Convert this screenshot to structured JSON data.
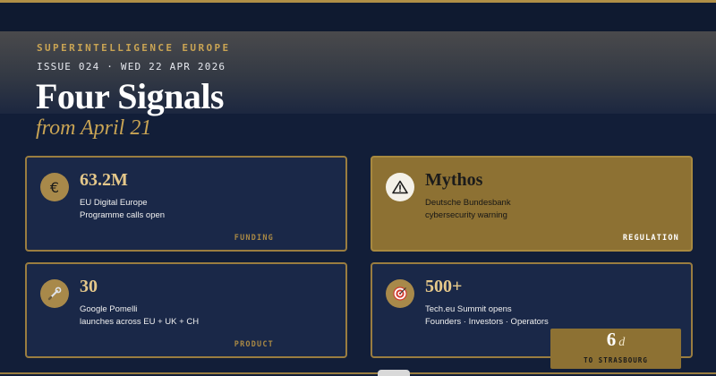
{
  "brand": {
    "kicker": "SUPERINTELLIGENCE EUROPE",
    "issue": "ISSUE 024 · WED 22 APR 2026"
  },
  "hero": {
    "title": "Four Signals",
    "subtitle": "from April 21"
  },
  "cards": [
    {
      "icon": "euro-icon",
      "value": "63.2M",
      "lines": [
        "EU Digital Europe",
        "Programme calls open"
      ],
      "tag": "FUNDING"
    },
    {
      "icon": "warning-triangle-icon",
      "value": "Mythos",
      "lines": [
        "Deutsche Bundesbank",
        "cybersecurity warning"
      ],
      "tag": "REGULATION"
    },
    {
      "icon": "wrench-icon",
      "value": "30",
      "lines": [
        "Google Pomelli",
        "launches across EU + UK + CH"
      ],
      "tag": "PRODUCT"
    },
    {
      "icon": "target-icon",
      "value": "500+",
      "lines": [
        "Tech.eu Summit opens",
        "Founders · Investors · Operators"
      ],
      "tag": ""
    }
  ],
  "countdown": {
    "number": "6",
    "unit": "d",
    "label": "TO STRASBOURG"
  },
  "colors": {
    "accent_gold": "#c9a454",
    "card_navy": "#1a2848",
    "card_gold": "#8d7133",
    "background": "#111d35"
  }
}
